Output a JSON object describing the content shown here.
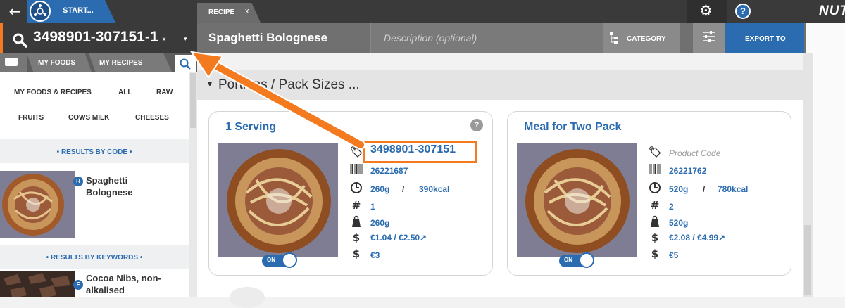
{
  "topbar": {
    "start_label": "START...",
    "recipe_tab_label": "RECIPE",
    "recipe_tab_close": "x",
    "brand": "NUT",
    "icons": {
      "back": "back-arrow-icon",
      "gear": "gear-icon",
      "help": "help-icon"
    }
  },
  "search": {
    "value": "3498901-307151-1",
    "clear": "x",
    "dropdown": "▾"
  },
  "recipe": {
    "title": "Spaghetti Bolognese",
    "description_placeholder": "Description (optional)",
    "category_label": "CATEGORY",
    "export_label": "EXPORT TO"
  },
  "left_panel": {
    "tabs": [
      "MY FOODS",
      "MY RECIPES"
    ],
    "filters_row1": [
      "MY FOODS & RECIPES",
      "ALL",
      "RAW"
    ],
    "filters_row2": [
      "FRUITS",
      "COWS MILK",
      "CHEESES"
    ],
    "results_by_code_label": "• RESULTS BY CODE •",
    "results_by_keywords_label": "• RESULTS BY KEYWORDS •",
    "code_results": [
      {
        "badge": "R",
        "name": "Spaghetti Bolognese"
      }
    ],
    "keyword_results": [
      {
        "badge": "F",
        "name": "Cocoa Nibs, non-alkalised"
      }
    ]
  },
  "portions": {
    "title": "Portions / Pack Sizes ...",
    "cards": [
      {
        "title": "1 Serving",
        "help": "?",
        "product_code": "3498901-307151",
        "barcode": "26221687",
        "weight": "260g",
        "sep": "/",
        "energy": "390kcal",
        "count": "1",
        "pack_weight": "260g",
        "cost": "€1.04 / €2.50↗",
        "price": "€3",
        "toggle": "ON"
      },
      {
        "title": "Meal for Two Pack",
        "product_code_placeholder": "Product Code",
        "barcode": "26221762",
        "weight": "520g",
        "sep": "/",
        "energy": "780kcal",
        "count": "2",
        "pack_weight": "520g",
        "cost": "€2.08 / €4.99↗",
        "price": "€5",
        "toggle": "ON"
      }
    ]
  },
  "colors": {
    "accent": "#2b6cb0",
    "highlight": "#f47a20",
    "dark": "#3a3a3a"
  }
}
